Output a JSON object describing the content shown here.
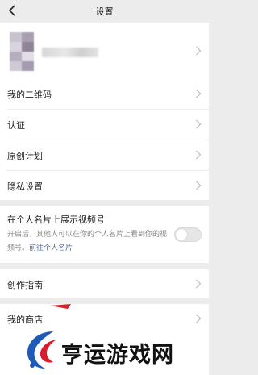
{
  "nav": {
    "title": "设置",
    "back_icon": "chevron-left-icon"
  },
  "profile": {
    "chevron_icon": "chevron-right-icon"
  },
  "group1": [
    {
      "label": "我的二维码"
    },
    {
      "label": "认证"
    },
    {
      "label": "原创计划"
    },
    {
      "label": "隐私设置"
    }
  ],
  "video_card": {
    "label": "在个人名片上展示视频号",
    "desc": "开启后，其他人可以在你的个人名片上看到你的视频号。",
    "link": "前往个人名片",
    "toggle_on": false
  },
  "group2": [
    {
      "label": "创作指南"
    }
  ],
  "group3": [
    {
      "label": "我的商店"
    }
  ],
  "watermark": {
    "text": "亨运游戏网"
  },
  "colors": {
    "background": "#ececec",
    "link": "#576b95",
    "watermark_red": "#d81e2b",
    "watermark_blue": "#1e5bb8"
  }
}
